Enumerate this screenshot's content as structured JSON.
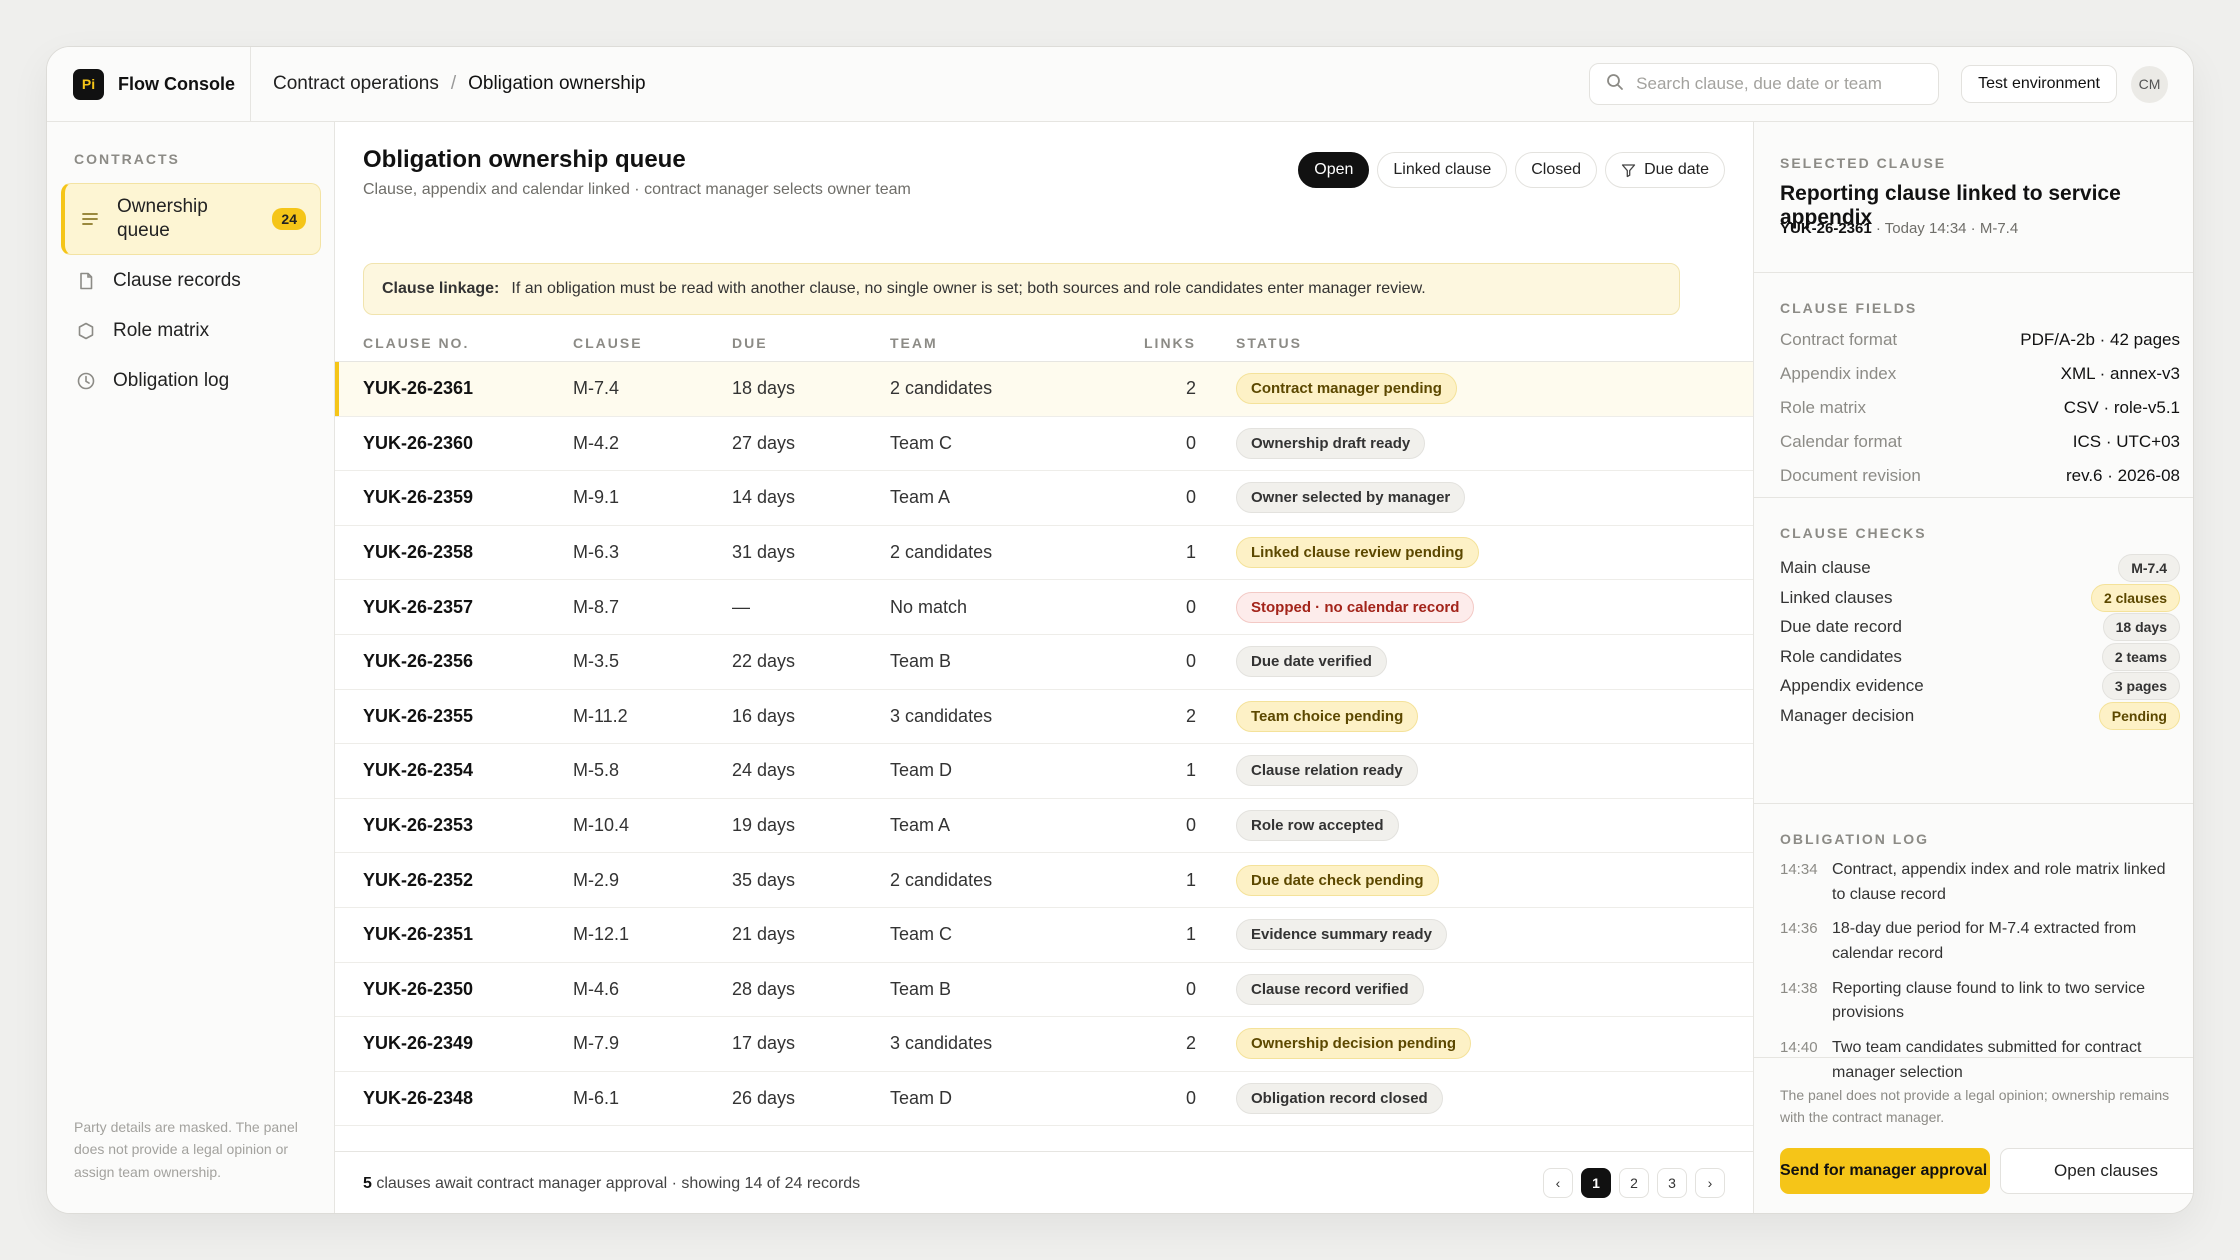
{
  "app": {
    "logo": "Pi",
    "name": "Flow Console"
  },
  "breadcrumb": {
    "section": "Contract operations",
    "sep": "/",
    "page": "Obligation ownership"
  },
  "search": {
    "placeholder": "Search clause, due date or team"
  },
  "env_label": "Test environment",
  "avatar": "CM",
  "sidebar": {
    "heading": "CONTRACTS",
    "items": [
      {
        "label": "Ownership queue",
        "badge": "24",
        "icon": "list-icon"
      },
      {
        "label": "Clause records",
        "icon": "document-icon"
      },
      {
        "label": "Role matrix",
        "icon": "shield-icon"
      },
      {
        "label": "Obligation log",
        "icon": "clock-icon"
      }
    ],
    "footer": "Party details are masked. The panel does not provide a legal opinion or assign team ownership."
  },
  "main": {
    "title": "Obligation ownership queue",
    "subtitle": "Clause, appendix and calendar linked · contract manager selects owner team",
    "filters": [
      "Open",
      "Linked clause",
      "Closed",
      "Due date"
    ],
    "notice": {
      "title": "Clause linkage:",
      "text": "If an obligation must be read with another clause, no single owner is set; both sources and role candidates enter manager review."
    },
    "columns": [
      "CLAUSE NO.",
      "CLAUSE",
      "DUE",
      "TEAM",
      "LINKS",
      "STATUS"
    ],
    "rows": [
      {
        "no": "YUK-26-2361",
        "clause": "M-7.4",
        "due": "18 days",
        "team": "2 candidates",
        "links": "2",
        "status": "Contract manager pending",
        "tone": "warn"
      },
      {
        "no": "YUK-26-2360",
        "clause": "M-4.2",
        "due": "27 days",
        "team": "Team C",
        "links": "0",
        "status": "Ownership draft ready",
        "tone": "neutral"
      },
      {
        "no": "YUK-26-2359",
        "clause": "M-9.1",
        "due": "14 days",
        "team": "Team A",
        "links": "0",
        "status": "Owner selected by manager",
        "tone": "neutral"
      },
      {
        "no": "YUK-26-2358",
        "clause": "M-6.3",
        "due": "31 days",
        "team": "2 candidates",
        "links": "1",
        "status": "Linked clause review pending",
        "tone": "warn"
      },
      {
        "no": "YUK-26-2357",
        "clause": "M-8.7",
        "due": "—",
        "team": "No match",
        "links": "0",
        "status": "Stopped · no calendar record",
        "tone": "err"
      },
      {
        "no": "YUK-26-2356",
        "clause": "M-3.5",
        "due": "22 days",
        "team": "Team B",
        "links": "0",
        "status": "Due date verified",
        "tone": "neutral"
      },
      {
        "no": "YUK-26-2355",
        "clause": "M-11.2",
        "due": "16 days",
        "team": "3 candidates",
        "links": "2",
        "status": "Team choice pending",
        "tone": "warn"
      },
      {
        "no": "YUK-26-2354",
        "clause": "M-5.8",
        "due": "24 days",
        "team": "Team D",
        "links": "1",
        "status": "Clause relation ready",
        "tone": "neutral"
      },
      {
        "no": "YUK-26-2353",
        "clause": "M-10.4",
        "due": "19 days",
        "team": "Team A",
        "links": "0",
        "status": "Role row accepted",
        "tone": "neutral"
      },
      {
        "no": "YUK-26-2352",
        "clause": "M-2.9",
        "due": "35 days",
        "team": "2 candidates",
        "links": "1",
        "status": "Due date check pending",
        "tone": "warn"
      },
      {
        "no": "YUK-26-2351",
        "clause": "M-12.1",
        "due": "21 days",
        "team": "Team C",
        "links": "1",
        "status": "Evidence summary ready",
        "tone": "neutral"
      },
      {
        "no": "YUK-26-2350",
        "clause": "M-4.6",
        "due": "28 days",
        "team": "Team B",
        "links": "0",
        "status": "Clause record verified",
        "tone": "neutral"
      },
      {
        "no": "YUK-26-2349",
        "clause": "M-7.9",
        "due": "17 days",
        "team": "3 candidates",
        "links": "2",
        "status": "Ownership decision pending",
        "tone": "warn"
      },
      {
        "no": "YUK-26-2348",
        "clause": "M-6.1",
        "due": "26 days",
        "team": "Team D",
        "links": "0",
        "status": "Obligation record closed",
        "tone": "neutral"
      }
    ],
    "footer": {
      "count": "5",
      "text": " clauses await contract manager approval · showing 14 of 24 records"
    },
    "pager": [
      "‹",
      "1",
      "2",
      "3",
      "›"
    ]
  },
  "panel": {
    "selected_heading": "SELECTED CLAUSE",
    "title": "Reporting clause linked to service appendix",
    "meta_id": "YUK-26-2361",
    "meta_rest": " · Today 14:34 · M-7.4",
    "fields_heading": "CLAUSE FIELDS",
    "fields": [
      {
        "k": "Contract format",
        "v": "PDF/A-2b · 42 pages"
      },
      {
        "k": "Appendix index",
        "v": "XML · annex-v3"
      },
      {
        "k": "Role matrix",
        "v": "CSV · role-v5.1"
      },
      {
        "k": "Calendar format",
        "v": "ICS · UTC+03"
      },
      {
        "k": "Document revision",
        "v": "rev.6 · 2026-08"
      }
    ],
    "checks_heading": "CLAUSE CHECKS",
    "checks": [
      {
        "k": "Main clause",
        "v": "M-7.4",
        "tone": "neutral"
      },
      {
        "k": "Linked clauses",
        "v": "2 clauses",
        "tone": "warn"
      },
      {
        "k": "Due date record",
        "v": "18 days",
        "tone": "neutral"
      },
      {
        "k": "Role candidates",
        "v": "2 teams",
        "tone": "neutral"
      },
      {
        "k": "Appendix evidence",
        "v": "3 pages",
        "tone": "neutral"
      },
      {
        "k": "Manager decision",
        "v": "Pending",
        "tone": "warn"
      }
    ],
    "log_heading": "OBLIGATION LOG",
    "log": [
      {
        "t": "14:34",
        "text": "Contract, appendix index and role matrix linked to clause record"
      },
      {
        "t": "14:36",
        "text": "18-day due period for M-7.4 extracted from calendar record"
      },
      {
        "t": "14:38",
        "text": "Reporting clause found to link to two service provisions"
      },
      {
        "t": "14:40",
        "text": "Two team candidates submitted for contract manager selection"
      }
    ],
    "note": "The panel does not provide a legal opinion; ownership remains with the contract manager.",
    "primary_btn": "Send for manager approval",
    "secondary_btn": "Open clauses"
  }
}
